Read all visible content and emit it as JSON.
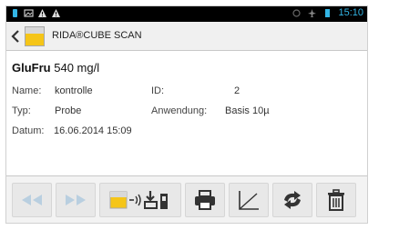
{
  "statusbar": {
    "time": "15:10",
    "icons": [
      "notification-icon",
      "image-icon",
      "warning-icon",
      "warning-icon",
      "sync-icon",
      "airplane-icon",
      "battery-icon"
    ]
  },
  "actionbar": {
    "title": "RIDA®CUBE SCAN",
    "icon": "cube-app-icon"
  },
  "result": {
    "analyte": "GluFru",
    "value": "540 mg/l",
    "fields": {
      "name_label": "Name:",
      "name_value": "kontrolle",
      "id_label": "ID:",
      "id_value": "2",
      "typ_label": "Typ:",
      "typ_value": "Probe",
      "anwendung_label": "Anwendung:",
      "anwendung_value": "Basis 10µ",
      "datum_label": "Datum:",
      "datum_value": "16.06.2014 15:09"
    }
  },
  "toolbar": {
    "buttons": [
      "previous-icon",
      "next-icon",
      "transfer-icon",
      "print-icon",
      "curve-icon",
      "refresh-icon",
      "delete-icon"
    ]
  },
  "colors": {
    "accent": "#33b5e5",
    "app_yellow": "#f5c518",
    "disabled_icon": "#b9cfe0",
    "icon_dark": "#333333"
  }
}
